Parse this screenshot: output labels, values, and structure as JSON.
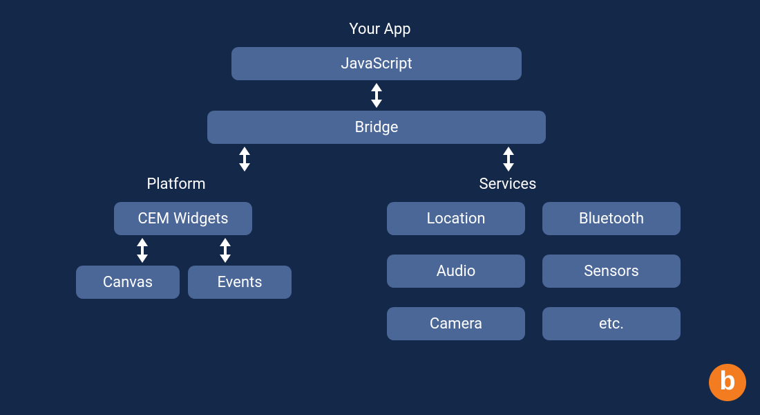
{
  "title": "Your App",
  "top": {
    "javascript": "JavaScript",
    "bridge": "Bridge"
  },
  "platform": {
    "label": "Platform",
    "cem_widgets": "CEM Widgets",
    "canvas": "Canvas",
    "events": "Events"
  },
  "services": {
    "label": "Services",
    "items": {
      "location": "Location",
      "bluetooth": "Bluetooth",
      "audio": "Audio",
      "sensors": "Sensors",
      "camera": "Camera",
      "etc": "etc."
    }
  },
  "logo_letter": "b",
  "colors": {
    "background": "#142849",
    "node": "#4b6797",
    "text": "#ffffff",
    "logo": "#f47c20"
  }
}
